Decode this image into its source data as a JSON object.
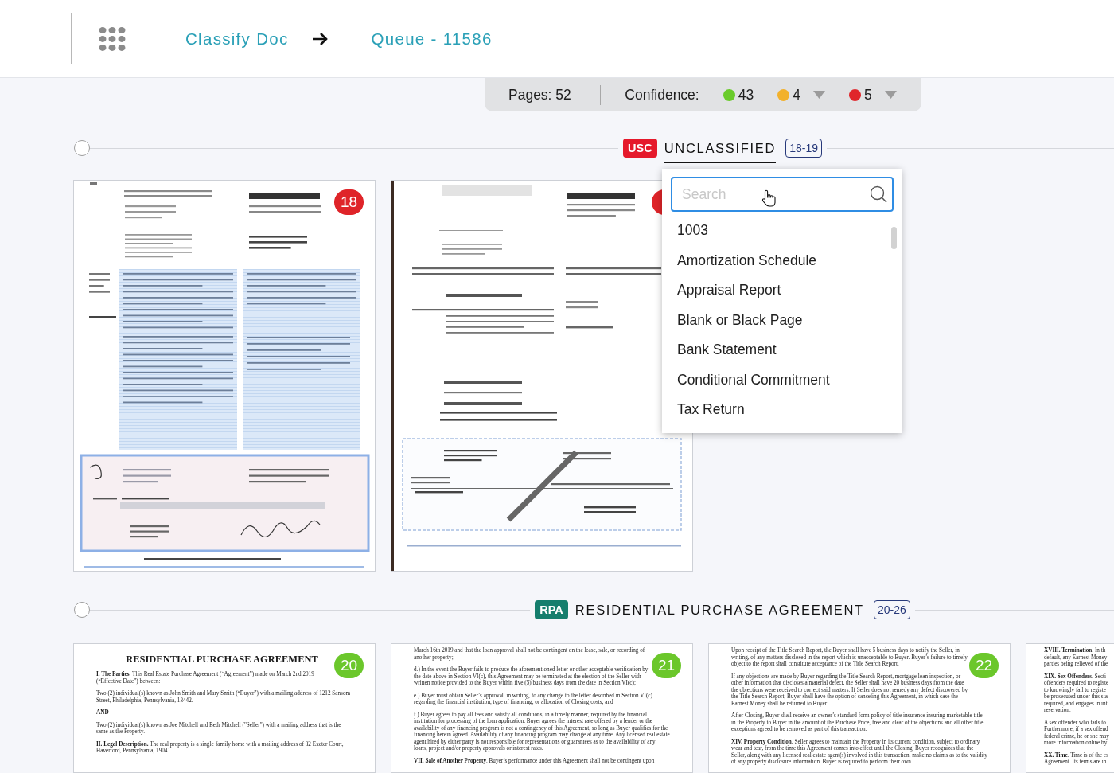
{
  "header": {
    "breadcrumbs": [
      {
        "label": "Classify Doc"
      },
      {
        "label": "Queue - 11586"
      }
    ]
  },
  "stats": {
    "pages": "Pages: 52",
    "confidence_label": "Confidence:",
    "counts": [
      {
        "value": "43",
        "color": "#6acb2b",
        "dropdown": false
      },
      {
        "value": "4",
        "color": "#f2b12c",
        "dropdown": true
      },
      {
        "value": "5",
        "color": "#e0262b",
        "dropdown": true
      }
    ]
  },
  "sections": [
    {
      "checked": false,
      "code": "USC",
      "color": "#e5192b",
      "title": "UNCLASSIFIED",
      "range": "18-19",
      "selected": true,
      "pages": [
        {
          "kind": "scan",
          "number": "18",
          "color": "#df2429"
        },
        {
          "kind": "scan",
          "color": "#df2429"
        }
      ]
    },
    {
      "checked": false,
      "code": "RPA",
      "color": "#157e6d",
      "title": "RESIDENTIAL PURCHASE AGREEMENT",
      "range": "20-26",
      "selected": false,
      "pages": [
        {
          "kind": "text",
          "number": "20",
          "color": "#6bc72b",
          "title": "RESIDENTIAL PURCHASE AGREEMENT",
          "paragraphs": [
            {
              "kind": "plain",
              "text": "**I. The Parties**. This Real Estate Purchase Agreement (“Agreement”) made on March 2nd 2019 (“Effective Date”) between:"
            },
            {
              "kind": "plain",
              "text": "Two (2) individual(s) known as John Smith and Mary Smith (“Buyer”) with a mailing address of 1212 Sansom Street, Philadelphia, Pennsylvania, 13442."
            },
            {
              "kind": "bold",
              "text": "AND"
            },
            {
              "kind": "plain",
              "text": "Two (2) individual(s) known as Joe Mitchell and Beth Mitchell (\"Seller\") with a mailing address that is the same as the Property."
            },
            {
              "kind": "plain",
              "text": "**II. Legal Description.** The real property is a single-family home with a mailing address of 32 Exeter Court, Haverford, Pennsylvania, 19041."
            }
          ]
        },
        {
          "kind": "text",
          "number": "21",
          "color": "#6bc72b",
          "paragraphs": [
            {
              "kind": "plain",
              "text": "March 16th 2019 and that the loan approval shall not be contingent on the lease, sale, or recording of another property;"
            },
            {
              "kind": "plain",
              "text": "d.) In the event the Buyer fails to produce the aforementioned letter or other acceptable verification by the date above in Section VI(c), this Agreement may be terminated at the election of the Seller with written notice provided to the Buyer within five (5) business days from the date in Section VI(c);"
            },
            {
              "kind": "plain",
              "text": "e.) Buyer must obtain Seller’s approval, in writing, to any change to the letter described in Section VI(c) regarding the financial institution, type of financing, or allocation of Closing costs; and"
            },
            {
              "kind": "plain",
              "text": "f.) Buyer agrees to pay all fees and satisfy all conditions, in a timely manner, required by the financial institution for processing of the loan application. Buyer agrees the interest rate offered by a lender or the availability of any financing program is not a contingency of this Agreement, so long as Buyer qualifies for the financing herein agreed. Availability of any financing program may change at any time. Any licensed real estate agent hired by either party is not responsible for representations or guarantees as to the availability of any loans, project and/or property approvals or interest rates."
            },
            {
              "kind": "plain",
              "text": "**VII. Sale of Another Property**. Buyer’s performance under this Agreement shall not be contingent upon"
            }
          ]
        },
        {
          "kind": "text",
          "number": "22",
          "color": "#6bc72b",
          "paragraphs": [
            {
              "kind": "plain",
              "text": "Upon receipt of the Title Search Report, the Buyer shall have 5 business days to notify the Seller, in writing, of any matters disclosed in the report which is unacceptable to Buyer. Buyer’s failure to timely object to the report shall constitute acceptance of the Title Search Report."
            },
            {
              "kind": "plain",
              "text": "If any objections are made by Buyer regarding the Title Search Report, mortgage loan inspection, or other information that discloses a material defect, the Seller shall have 20 business days from the date the objections were received to correct said matters. If Seller does not remedy any defect discovered by the Title Search Report, Buyer shall have the option of canceling this Agreement, in which case the Earnest Money shall be returned to Buyer."
            },
            {
              "kind": "plain",
              "text": "After Closing, Buyer shall receive an owner’s standard form policy of title insurance insuring marketable title in the Property to Buyer in the amount of the Purchase Price, free and clear of the objections and all other title exceptions agreed to be removed as part of this transaction."
            },
            {
              "kind": "plain",
              "text": "**XIV. Property Condition**. Seller agrees to maintain the Property in its current condition, subject to ordinary wear and tear, from the time this Agreement comes into effect until the Closing. Buyer recognizes that the Seller, along with any licensed real estate agent(s) involved in this transaction, make no claims as to the validity of any property disclosure information. Buyer is required to perform their own"
            }
          ]
        },
        {
          "kind": "cut",
          "paragraphs": [
            {
              "lines": [
                "**XVIII. Termination**. In th",
                "default, any Earnest Money",
                "parties being relieved of the"
              ]
            },
            {
              "lines": [
                "**XIX. Sex Offenders**. Secti",
                "offenders required to registe",
                "to knowingly fail to registe",
                "be prosecuted under this sta",
                "required, and engages in int",
                "reservation."
              ]
            },
            {
              "lines": [
                "A sex offender who fails to",
                "Furthermore, if a sex offend",
                "federal crime, he or she may",
                "more information online by"
              ]
            },
            {
              "lines": [
                "**XX. Time**. Time is of the es",
                "Agreement. Its terms are in"
              ]
            }
          ]
        }
      ]
    }
  ],
  "dropdown": {
    "search": {
      "placeholder": "Search"
    },
    "options": [
      "1003",
      "Amortization Schedule",
      "Appraisal Report",
      "Blank or Black Page",
      "Bank Statement",
      "Conditional Commitment",
      "Tax Return"
    ]
  }
}
